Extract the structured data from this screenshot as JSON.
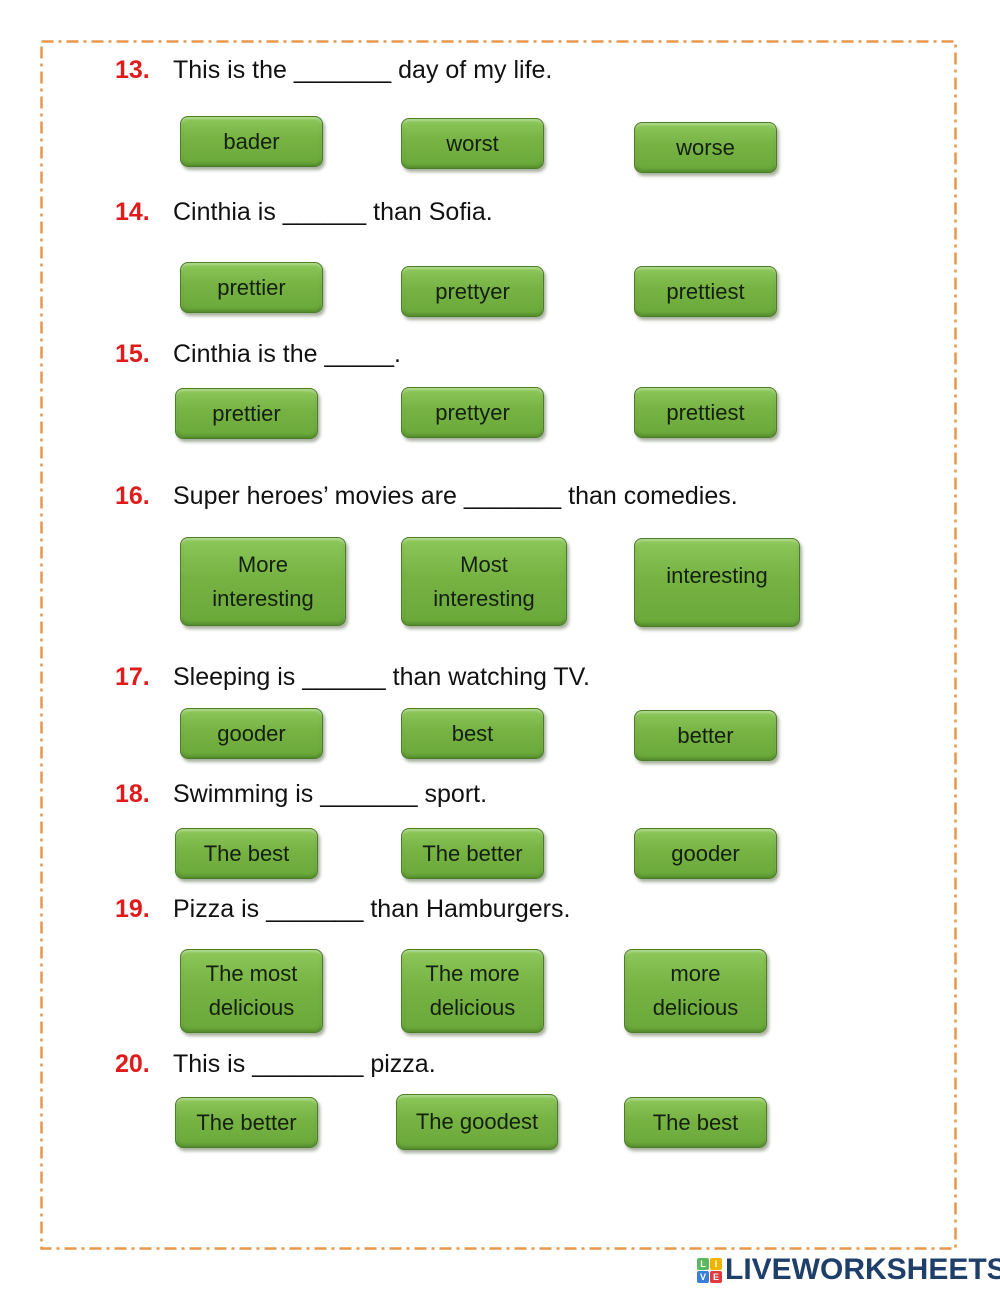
{
  "questions": [
    {
      "number": "13.",
      "text": "This is the _______ day of my life.",
      "options": [
        "bader",
        "worst",
        "worse"
      ]
    },
    {
      "number": "14.",
      "text": "Cinthia is ______ than Sofia.",
      "options": [
        "prettier",
        "prettyer",
        "prettiest"
      ]
    },
    {
      "number": "15.",
      "text": "Cinthia is the _____.",
      "options": [
        "prettier",
        "prettyer",
        "prettiest"
      ]
    },
    {
      "number": "16.",
      "text": "Super heroes’ movies are _______ than comedies.",
      "options": [
        "More\ninteresting",
        "Most\ninteresting",
        "interesting"
      ]
    },
    {
      "number": "17.",
      "text": "Sleeping is ______ than watching TV.",
      "options": [
        "gooder",
        "best",
        "better"
      ]
    },
    {
      "number": "18.",
      "text": "Swimming is _______ sport.",
      "options": [
        "The best",
        "The better",
        "gooder"
      ]
    },
    {
      "number": "19.",
      "text": "Pizza is _______ than Hamburgers.",
      "options": [
        "The most\ndelicious",
        "The more\ndelicious",
        "more\ndelicious"
      ]
    },
    {
      "number": "20.",
      "text": "This is ________ pizza.",
      "options": [
        "The better",
        "The goodest",
        "The best"
      ]
    }
  ],
  "logo": {
    "tiles": [
      "L",
      "I",
      "V",
      "E"
    ],
    "tile_colors": [
      "#5cb85c",
      "#f0b400",
      "#3a7fd5",
      "#e0393e"
    ],
    "text": "LIVEWORKSHEETS"
  },
  "colors": {
    "question_number": "#e01b1b",
    "button_green": "#76b343",
    "border_orange": "#e8974a"
  }
}
